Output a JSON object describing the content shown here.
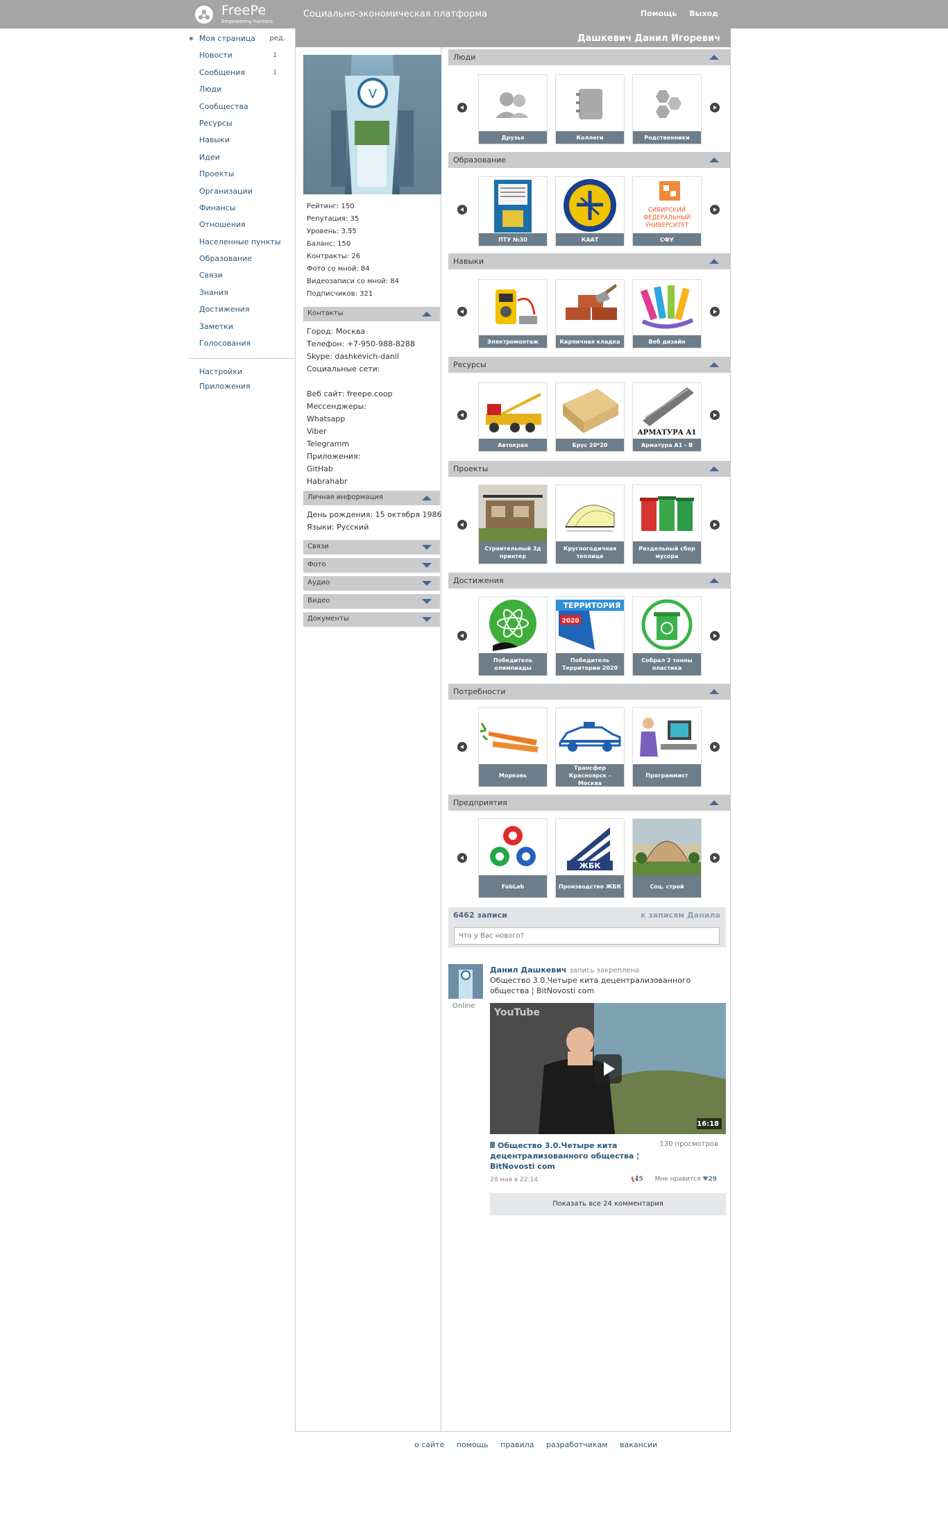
{
  "header": {
    "logo_name": "FreePe",
    "logo_tagline": "Empowering humans",
    "platform_title": "Социально-экономическая платформа",
    "help": "Помощь",
    "logout": "Выход"
  },
  "nav": {
    "items": [
      {
        "label": "Моя страница",
        "extra": "ред."
      },
      {
        "label": "Новости",
        "count": "1"
      },
      {
        "label": "Сообщения",
        "count": "1"
      },
      {
        "label": "Люди"
      },
      {
        "label": "Сообщества"
      },
      {
        "label": "Ресурсы"
      },
      {
        "label": "Навыки"
      },
      {
        "label": "Идеи"
      },
      {
        "label": "Проекты"
      },
      {
        "label": "Организации"
      },
      {
        "label": "Финансы"
      },
      {
        "label": "Отношения"
      },
      {
        "label": "Населенные пункты"
      },
      {
        "label": "Образование"
      },
      {
        "label": "Связи"
      },
      {
        "label": "Знания"
      },
      {
        "label": "Достижения"
      },
      {
        "label": "Заметки"
      },
      {
        "label": "Голосования"
      }
    ],
    "bottom": [
      "Настройки",
      "Приложения"
    ]
  },
  "profile": {
    "name": "Дашкевич Данил Игоревич",
    "stats": [
      "Рейтинг: 150",
      "Репутация: 35",
      "Уровень: 3.55",
      "Баланс: 150",
      "Контракты: 26",
      "Фото со мной: 84",
      "Видеозаписи со мной: 84",
      "Подписчиков: 321"
    ],
    "contacts_title": "Контакты",
    "contacts": [
      "Город: Москва",
      "Телефон: +7-950-988-8288",
      "Skype: dashkevich-danil",
      "Социальные сети:",
      "",
      "Веб сайт: freepe.coop",
      "Мессенджеры:",
      "Whatsapp",
      "Viber",
      "Telegramm",
      "Приложения:",
      "GitHab",
      "Habrahabr"
    ],
    "personal_title": "Личная информация",
    "personal": [
      "День рождения: 15 октября 1986",
      "Языки: Русский"
    ],
    "collapsed": [
      "Связи",
      "Фото",
      "Аудио",
      "Видео",
      "Документы"
    ]
  },
  "sections": [
    {
      "title": "Люди",
      "cards": [
        "Друзья",
        "Коллеги",
        "Родственники"
      ]
    },
    {
      "title": "Образование",
      "cards": [
        "ПТУ №30",
        "КААТ",
        "СФУ"
      ]
    },
    {
      "title": "Навыки",
      "cards": [
        "Электромонтаж",
        "Кирпичная кладка",
        "Веб дизайн"
      ]
    },
    {
      "title": "Ресурсы",
      "cards": [
        "Автокран",
        "Брус 20*20",
        "Арматура А1 - В"
      ]
    },
    {
      "title": "Проекты",
      "cards": [
        "Строительный 3д принтер",
        "Круглогодичная теплица",
        "Раздельный сбор мусора"
      ]
    },
    {
      "title": "Достижения",
      "cards": [
        "Победитель олимпиады",
        "Победитель Территории 2020",
        "Собрал 2 тонны пластика"
      ]
    },
    {
      "title": "Потребности",
      "cards": [
        "Морковь",
        "Трансфер Красноярск - Москва",
        "Программист"
      ]
    },
    {
      "title": "Предприятия",
      "cards": [
        "FabLab",
        "Производство ЖБК",
        "Соц. строй"
      ]
    }
  ],
  "card_image_text": {
    "armatura": "АРМАТУРА А1",
    "territory": "ТЕРРИТОРИЯ",
    "territory_year": "2020",
    "zhbk": "ЖБК",
    "sfu": "СИБИРСКИЙ ФЕДЕРАЛЬНЫЙ УНИВЕРСИТЕТ"
  },
  "wall": {
    "count": "6462 записи",
    "to_posts": "к записям Данила",
    "placeholder": "Что у Вас нового?",
    "post": {
      "author": "Данил Дашкевич",
      "pinned": "запись закреплена",
      "online": "Online",
      "text": "Общество 3.0.Четыре кита децентрализованного общества ¦ BitNovosti com",
      "video_logo": "YouTube",
      "video_duration": "16:18",
      "video_title": "Общество 3.0.Четыре кита децентрализованного общества ¦ BitNovosti com",
      "views": "130 просмотров",
      "date": "28 мая в 22:14",
      "reposts": "5",
      "like_label": "Мне нравится",
      "likes": "29",
      "show_comments": "Показать все 24 комментария"
    }
  },
  "footer": [
    "о сайте",
    "помощь",
    "правила",
    "разработчикам",
    "вакансии"
  ],
  "colors": {
    "header_gray": "#a5a5a5",
    "section_gray": "#c9cbcd",
    "link_blue": "#2b587a",
    "caption_gray": "#6d7d8a",
    "triangle_blue": "#466a8e"
  }
}
